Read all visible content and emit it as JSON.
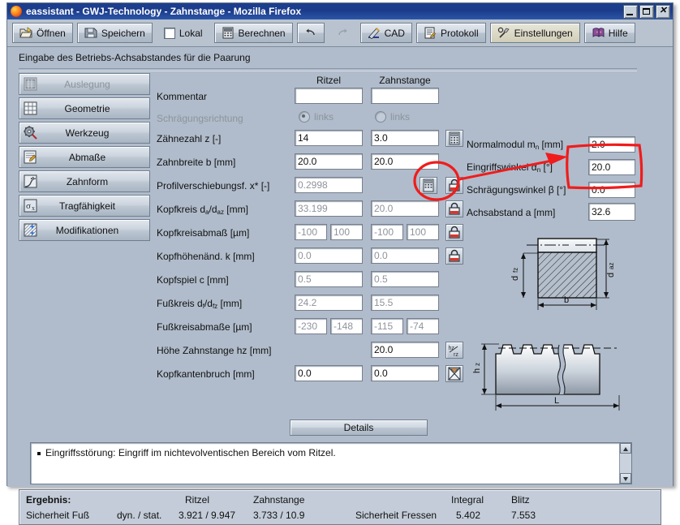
{
  "window": {
    "title": "eassistant - GWJ-Technology - Zahnstange - Mozilla Firefox",
    "app_icon": "firefox-icon",
    "minimize_label": "_",
    "maximize_label": "□",
    "close_label": "✕"
  },
  "toolbar": {
    "items": [
      {
        "label": "Öffnen",
        "icon": "open-folder-icon",
        "type": "button"
      },
      {
        "label": "Speichern",
        "icon": "floppy-disk-icon",
        "type": "button"
      },
      {
        "label": "Lokal",
        "icon": "checkbox-icon",
        "type": "checkbox",
        "checked": false
      },
      {
        "label": "Berechnen",
        "icon": "calculator-icon",
        "type": "button"
      },
      {
        "label": "",
        "icon": "undo-icon",
        "type": "icon-button"
      },
      {
        "label": "",
        "icon": "redo-icon",
        "type": "icon-button"
      },
      {
        "label": "CAD",
        "icon": "cad-pen-icon",
        "type": "button"
      },
      {
        "label": "Protokoll",
        "icon": "report-icon",
        "type": "button"
      },
      {
        "label": "Einstellungen",
        "icon": "settings-tools-icon",
        "type": "button"
      },
      {
        "label": "Hilfe",
        "icon": "help-book-icon",
        "type": "button"
      }
    ]
  },
  "header": {
    "hint": "Eingabe des Betriebs-Achsabstandes für die Paarung"
  },
  "sidebar": {
    "items": [
      {
        "label": "Auslegung",
        "icon": "calculator-icon",
        "disabled": true
      },
      {
        "label": "Geometrie",
        "icon": "grid-icon",
        "disabled": false
      },
      {
        "label": "Werkzeug",
        "icon": "gear-tool-icon",
        "disabled": false
      },
      {
        "label": "Abmaße",
        "icon": "measure-sheet-icon",
        "disabled": false
      },
      {
        "label": "Zahnform",
        "icon": "tooth-profile-icon",
        "disabled": false
      },
      {
        "label": "Tragfähigkeit",
        "icon": "sigma-x-icon",
        "disabled": false
      },
      {
        "label": "Modifikationen",
        "icon": "modifications-icon",
        "disabled": false
      }
    ]
  },
  "form": {
    "columns": [
      "Ritzel",
      "Zahnstange"
    ],
    "rows": [
      {
        "label": "Kommentar",
        "dim": false,
        "type": "text",
        "ritzel": "",
        "zahnstange": "",
        "readonly": false,
        "btn": ""
      },
      {
        "label": "Schrägungsrichtung",
        "dim": true,
        "type": "radio",
        "ritzel": "links",
        "zahnstange": "links",
        "ritzel_on": true,
        "zahnstange_on": false,
        "btn": ""
      },
      {
        "label": "Zähnezahl z [-]",
        "dim": false,
        "type": "text",
        "ritzel": "14",
        "zahnstange": "3.0",
        "readonly": false,
        "btn": "calculator-icon"
      },
      {
        "label": "Zahnbreite b [mm]",
        "dim": false,
        "type": "text",
        "ritzel": "20.0",
        "zahnstange": "20.0",
        "readonly": false,
        "btn": ""
      },
      {
        "label": "Profilverschiebungsf. x* [-]",
        "dim": false,
        "type": "text",
        "ritzel": "0.2998",
        "zahnstange": "",
        "readonly": true,
        "btn": "lock-icon",
        "btn2": "calculator-icon"
      },
      {
        "label": "Kopfkreis d_a/d_az [mm]",
        "dim": false,
        "type": "text",
        "ritzel": "33.199",
        "zahnstange": "20.0",
        "readonly": true,
        "btn": "lock-icon"
      },
      {
        "label": "Kopfkreisabmaß [µm]",
        "dim": false,
        "type": "pair",
        "ritzel": [
          "-100",
          "100"
        ],
        "zahnstange": [
          "-100",
          "100"
        ],
        "readonly": true,
        "btn": "lock-icon"
      },
      {
        "label": "Kopfhöhenänd. k [mm]",
        "dim": false,
        "type": "text",
        "ritzel": "0.0",
        "zahnstange": "0.0",
        "readonly": true,
        "btn": "lock-icon"
      },
      {
        "label": "Kopfspiel c [mm]",
        "dim": false,
        "type": "text",
        "ritzel": "0.5",
        "zahnstange": "0.5",
        "readonly": true,
        "btn": ""
      },
      {
        "label": "Fußkreis d_f/d_fz [mm]",
        "dim": false,
        "type": "text",
        "ritzel": "24.2",
        "zahnstange": "15.5",
        "readonly": true,
        "btn": ""
      },
      {
        "label": "Fußkreisabmaße [µm]",
        "dim": false,
        "type": "pair",
        "ritzel": [
          "-230",
          "-148"
        ],
        "zahnstange": [
          "-115",
          "-74"
        ],
        "readonly": true,
        "btn": ""
      },
      {
        "label": "Höhe Zahnstange hz [mm]",
        "dim": false,
        "type": "text",
        "ritzel": null,
        "zahnstange": "20.0",
        "readonly": false,
        "btn": "hz-rz-icon"
      },
      {
        "label": "Kopfkantenbruch [mm]",
        "dim": false,
        "type": "text",
        "ritzel": "0.0",
        "zahnstange": "0.0",
        "readonly": false,
        "btn": "chamfer-icon"
      }
    ],
    "details_button": "Details"
  },
  "params": {
    "rows": [
      {
        "label": "Normalmodul m",
        "sub": "n",
        "unit": " [mm]",
        "value": "2.0"
      },
      {
        "label": "Eingriffswinkel α",
        "sub": "n",
        "unit": " [°]",
        "value": "20.0"
      },
      {
        "label": "Schrägungswinkel β [°]",
        "sub": "",
        "unit": "",
        "value": "0.0"
      },
      {
        "label": "Achsabstand a [mm]",
        "sub": "",
        "unit": "",
        "value": "32.6"
      }
    ]
  },
  "diagrams": {
    "rack_section": {
      "name": "rack-cross-section-diagram",
      "labels": [
        "d",
        "fz",
        "d",
        "az",
        "b"
      ]
    },
    "rack_profile": {
      "name": "rack-profile-diagram",
      "labels": [
        "h",
        "z",
        "L"
      ]
    }
  },
  "messages": {
    "items": [
      "Eingriffsstörung: Eingriff im nichtevolventischen Bereich vom Ritzel."
    ]
  },
  "result": {
    "title": "Ergebnis:",
    "col_ritzel": "Ritzel",
    "col_zahnstange": "Zahnstange",
    "col_integral": "Integral",
    "col_blitz": "Blitz",
    "row1_label": "Sicherheit Fuß",
    "row1_mode": "dyn. / stat.",
    "row1_ritzel": "3.921  / 9.947",
    "row1_zahnstange": "3.733  / 10.9",
    "row2_label": "Sicherheit Fressen",
    "row2_integral": "5.402",
    "row2_blitz": "7.553"
  },
  "annotations": {
    "color": "#f01c1c",
    "highlight_rect": "achsabstand-field-highlight",
    "circle": "lock-icon-highlight",
    "arrow": "lock-to-achsabstand-arrow"
  }
}
